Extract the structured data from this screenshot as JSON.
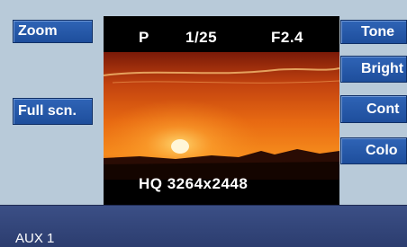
{
  "left_buttons": {
    "zoom": "Zoom",
    "full_screen": "Full scn."
  },
  "right_buttons": {
    "tone": "Tone",
    "brightness": "Bright",
    "contrast": "Cont",
    "color": "Colo"
  },
  "photo_info": {
    "mode": "P",
    "shutter": "1/25",
    "aperture": "F2.4",
    "quality_resolution": "HQ 3264x2448"
  },
  "status_bar": {
    "source": "AUX 1"
  },
  "colors": {
    "background": "#b8cad9",
    "button": "#2a5caa",
    "bottom_bar": "#33477a"
  }
}
